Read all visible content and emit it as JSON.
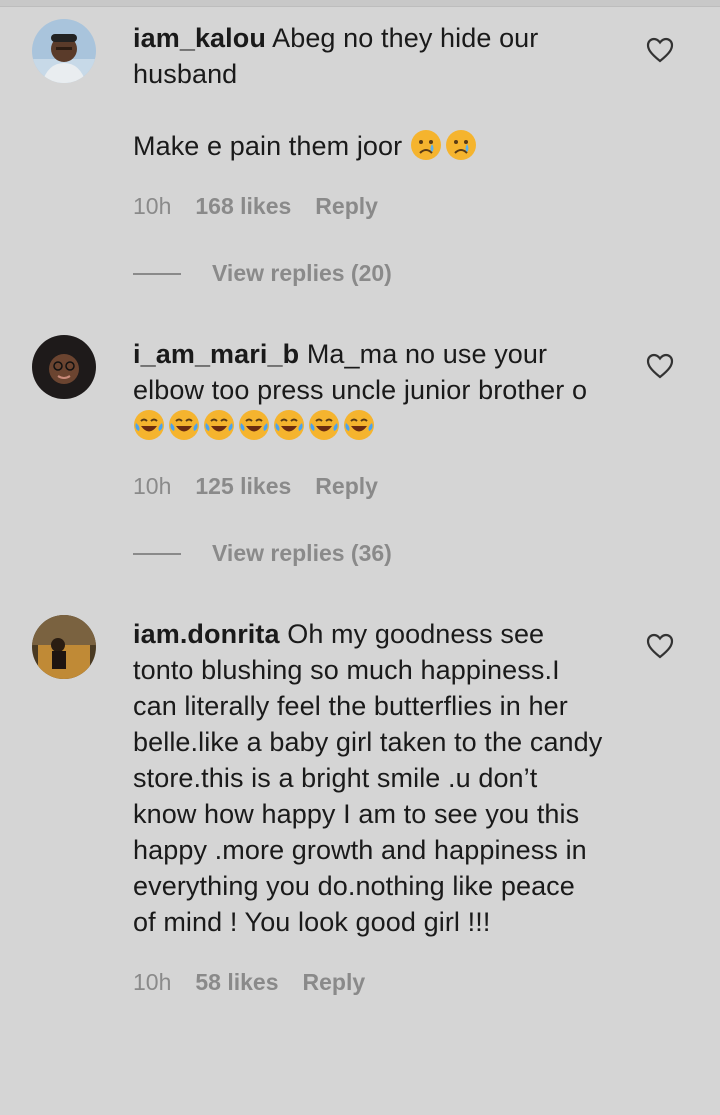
{
  "comments": [
    {
      "username": "iam_kalou",
      "text_lines": [
        "Abeg no they hide our",
        "husband",
        "",
        "Make e pain them joor"
      ],
      "emoji": "crying-face",
      "emoji_count": 2,
      "time": "10h",
      "likes": "168 likes",
      "reply": "Reply",
      "view_replies": "View replies (20)"
    },
    {
      "username": "i_am_mari_b",
      "text_lines": [
        "Ma_ma no use your",
        "elbow too press uncle junior brother o"
      ],
      "emoji": "tears-of-joy",
      "emoji_count": 7,
      "time": "10h",
      "likes": "125 likes",
      "reply": "Reply",
      "view_replies": "View replies (36)"
    },
    {
      "username": "iam.donrita",
      "text_lines": [
        "Oh my goodness see",
        "tonto blushing so much happiness.I",
        "can literally feel the butterflies in her",
        "belle.like a baby girl taken to the candy",
        "store.this is a bright smile .u don’t",
        "know how happy I am to see you this",
        "happy .more growth and happiness in",
        "everything you do.nothing like peace",
        "of mind ! You look good girl !!!"
      ],
      "time": "10h",
      "likes": "58 likes",
      "reply": "Reply"
    }
  ]
}
